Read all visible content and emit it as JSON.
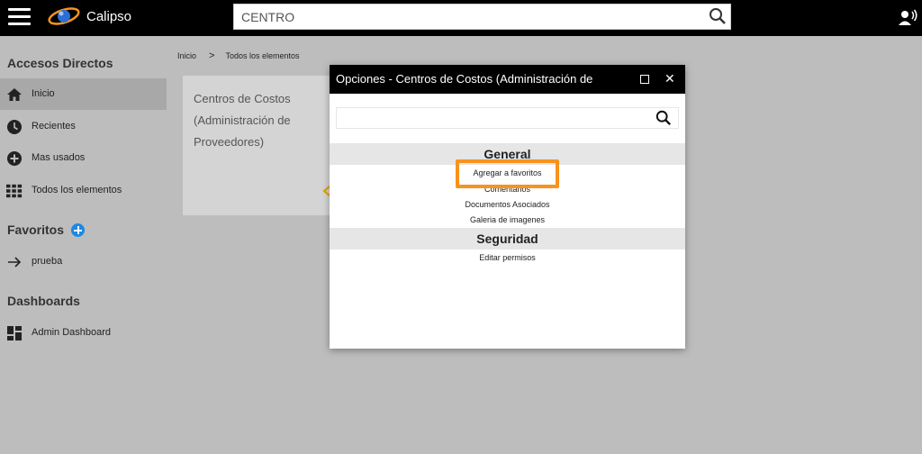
{
  "app": {
    "title": "Calipso"
  },
  "search": {
    "value": "CENTRO"
  },
  "sidebar": {
    "shortcuts_header": "Accesos Directos",
    "shortcuts": [
      {
        "label": "Inicio",
        "icon": "home-icon"
      },
      {
        "label": "Recientes",
        "icon": "clock-icon"
      },
      {
        "label": "Mas usados",
        "icon": "plus-circle-icon"
      },
      {
        "label": "Todos los elementos",
        "icon": "grid-icon"
      }
    ],
    "favorites_header": "Favoritos",
    "favorites": [
      {
        "label": "prueba",
        "icon": "arrow-right-icon"
      }
    ],
    "dashboards_header": "Dashboards",
    "dashboards": [
      {
        "label": "Admin Dashboard",
        "icon": "dashboard-icon"
      }
    ]
  },
  "breadcrumb": {
    "home": "Inicio",
    "separator": ">",
    "current": "Todos los elementos"
  },
  "card": {
    "title": "Centros de Costos (Administración de Proveedores)"
  },
  "modal": {
    "title": "Opciones - Centros de Costos (Administración de",
    "search_value": "",
    "sections": [
      {
        "header": "General",
        "options": [
          "Agregar a favoritos",
          "Comentarios",
          "Documentos Asociados",
          "Galeria de imagenes"
        ]
      },
      {
        "header": "Seguridad",
        "options": [
          "Editar permisos"
        ]
      }
    ]
  },
  "colors": {
    "topbar": "#000000",
    "sidebar_bg": "#bdbdbd",
    "accent": "#1e88e5",
    "highlight": "#f7931e"
  }
}
